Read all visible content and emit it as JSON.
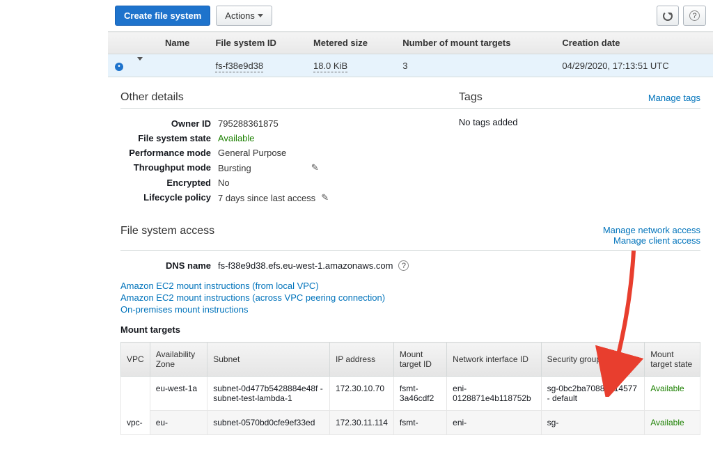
{
  "toolbar": {
    "create_label": "Create file system",
    "actions_label": "Actions"
  },
  "table_headers": {
    "name": "Name",
    "fs_id": "File system ID",
    "metered": "Metered size",
    "mount_targets": "Number of mount targets",
    "creation": "Creation date"
  },
  "fs_row": {
    "name": "",
    "id": "fs-f38e9d38",
    "metered": "18.0 KiB",
    "mount_count": "3",
    "creation": "04/29/2020, 17:13:51 UTC"
  },
  "other_details": {
    "title": "Other details",
    "owner_id_label": "Owner ID",
    "owner_id": "795288361875",
    "state_label": "File system state",
    "state": "Available",
    "perf_mode_label": "Performance mode",
    "perf_mode": "General Purpose",
    "throughput_label": "Throughput mode",
    "throughput": "Bursting",
    "encrypted_label": "Encrypted",
    "encrypted": "No",
    "lifecycle_label": "Lifecycle policy",
    "lifecycle": "7 days since last access"
  },
  "tags": {
    "title": "Tags",
    "manage": "Manage tags",
    "empty": "No tags added"
  },
  "fsa": {
    "title": "File system access",
    "manage_network": "Manage network access",
    "manage_client": "Manage client access",
    "dns_label": "DNS name",
    "dns_value": "fs-f38e9d38.efs.eu-west-1.amazonaws.com",
    "link_ec2_local": "Amazon EC2 mount instructions (from local VPC)",
    "link_ec2_peer": "Amazon EC2 mount instructions (across VPC peering connection)",
    "link_onprem": "On-premises mount instructions",
    "mt_title": "Mount targets"
  },
  "mt_headers": {
    "vpc": "VPC",
    "az": "Availability Zone",
    "subnet": "Subnet",
    "ip": "IP address",
    "mtid": "Mount target ID",
    "eni": "Network interface ID",
    "sg": "Security groups",
    "state": "Mount target state"
  },
  "mt_rows": [
    {
      "vpc": "",
      "az": "eu-west-1a",
      "subnet": "subnet-0d477b5428884e48f - subnet-test-lambda-1",
      "ip": "172.30.10.70",
      "mtid": "fsmt-3a46cdf2",
      "eni": "eni-0128871e4b118752b",
      "sg": "sg-0bc2ba70884414577 - default",
      "state": "Available"
    },
    {
      "vpc": "vpc-",
      "az": "eu-",
      "subnet": "subnet-0570bd0cfe9ef33ed",
      "ip": "172.30.11.114",
      "mtid": "fsmt-",
      "eni": "eni-",
      "sg": "sg-",
      "state": "Available"
    }
  ]
}
